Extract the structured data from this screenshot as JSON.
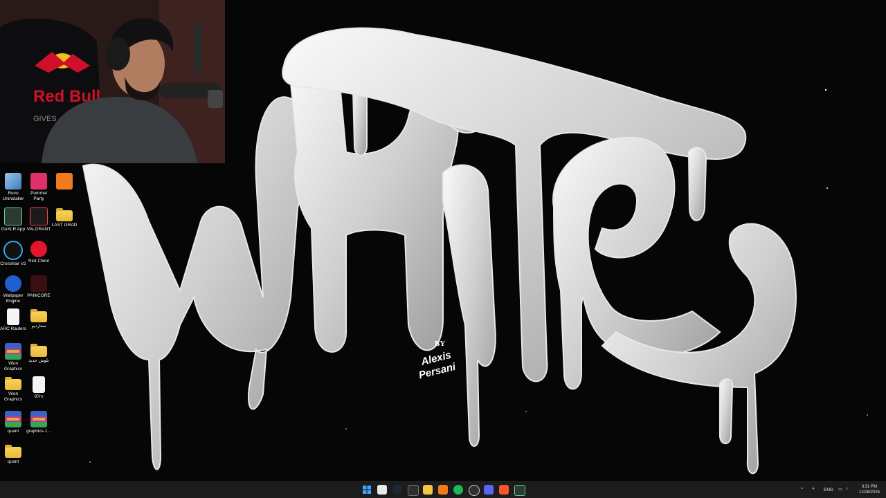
{
  "wallpaper": {
    "title": "WHITE",
    "credit_by": "BY",
    "credit_name_line1": "Alexis",
    "credit_name_line2": "Persani"
  },
  "webcam": {
    "brand_line1": "Red Bull",
    "brand_line2": "GIVES"
  },
  "desktop_icons": [
    {
      "label": "Revo Uninstaller",
      "icon": "revo-uninstaller-icon"
    },
    {
      "label": "Pummel Party",
      "icon": "pummel-party-icon"
    },
    {
      "label": "",
      "icon": "app-a-icon"
    },
    {
      "label": "GoXLR App",
      "icon": "goxlr-icon"
    },
    {
      "label": "VALORANT",
      "icon": "valorant-icon"
    },
    {
      "label": "LAST GRAD",
      "icon": "folder-icon"
    },
    {
      "label": "Crosshair V2",
      "icon": "crosshair-icon"
    },
    {
      "label": "Riot Client",
      "icon": "riot-client-icon"
    },
    {
      "label": "Wallpaper Engine",
      "icon": "wallpaper-engine-icon"
    },
    {
      "label": "PANICORE",
      "icon": "panicore-icon"
    },
    {
      "label": "ARC Raiders",
      "icon": "document-icon"
    },
    {
      "label": "ستارديو",
      "icon": "stardew-folder-icon"
    },
    {
      "label": "Vilon Graphics",
      "icon": "winrar-icon"
    },
    {
      "label": "تلوش جديد",
      "icon": "folder-icon"
    },
    {
      "label": "Vilon Graphics",
      "icon": "folder-icon"
    },
    {
      "label": "97rs",
      "icon": "document-icon"
    },
    {
      "label": "quant",
      "icon": "winrar-icon"
    },
    {
      "label": "graphics-1...",
      "icon": "winrar-icon"
    },
    {
      "label": "quant",
      "icon": "folder-icon"
    }
  ],
  "taskbar": {
    "apps": [
      "start-icon",
      "calendar-icon",
      "steam-icon",
      "app-icon",
      "file-explorer-icon",
      "app-a-icon",
      "spotify-icon",
      "obs-icon",
      "discord-icon",
      "brave-icon",
      "goxlr-icon"
    ],
    "tray": {
      "language": "ENG",
      "time": "3:31 PM",
      "date": "12/28/2025"
    }
  },
  "colors": {
    "taskbar_bg": "#1c1c1c",
    "desktop_bg": "#050505",
    "accent_blue": "#0a64d8"
  }
}
